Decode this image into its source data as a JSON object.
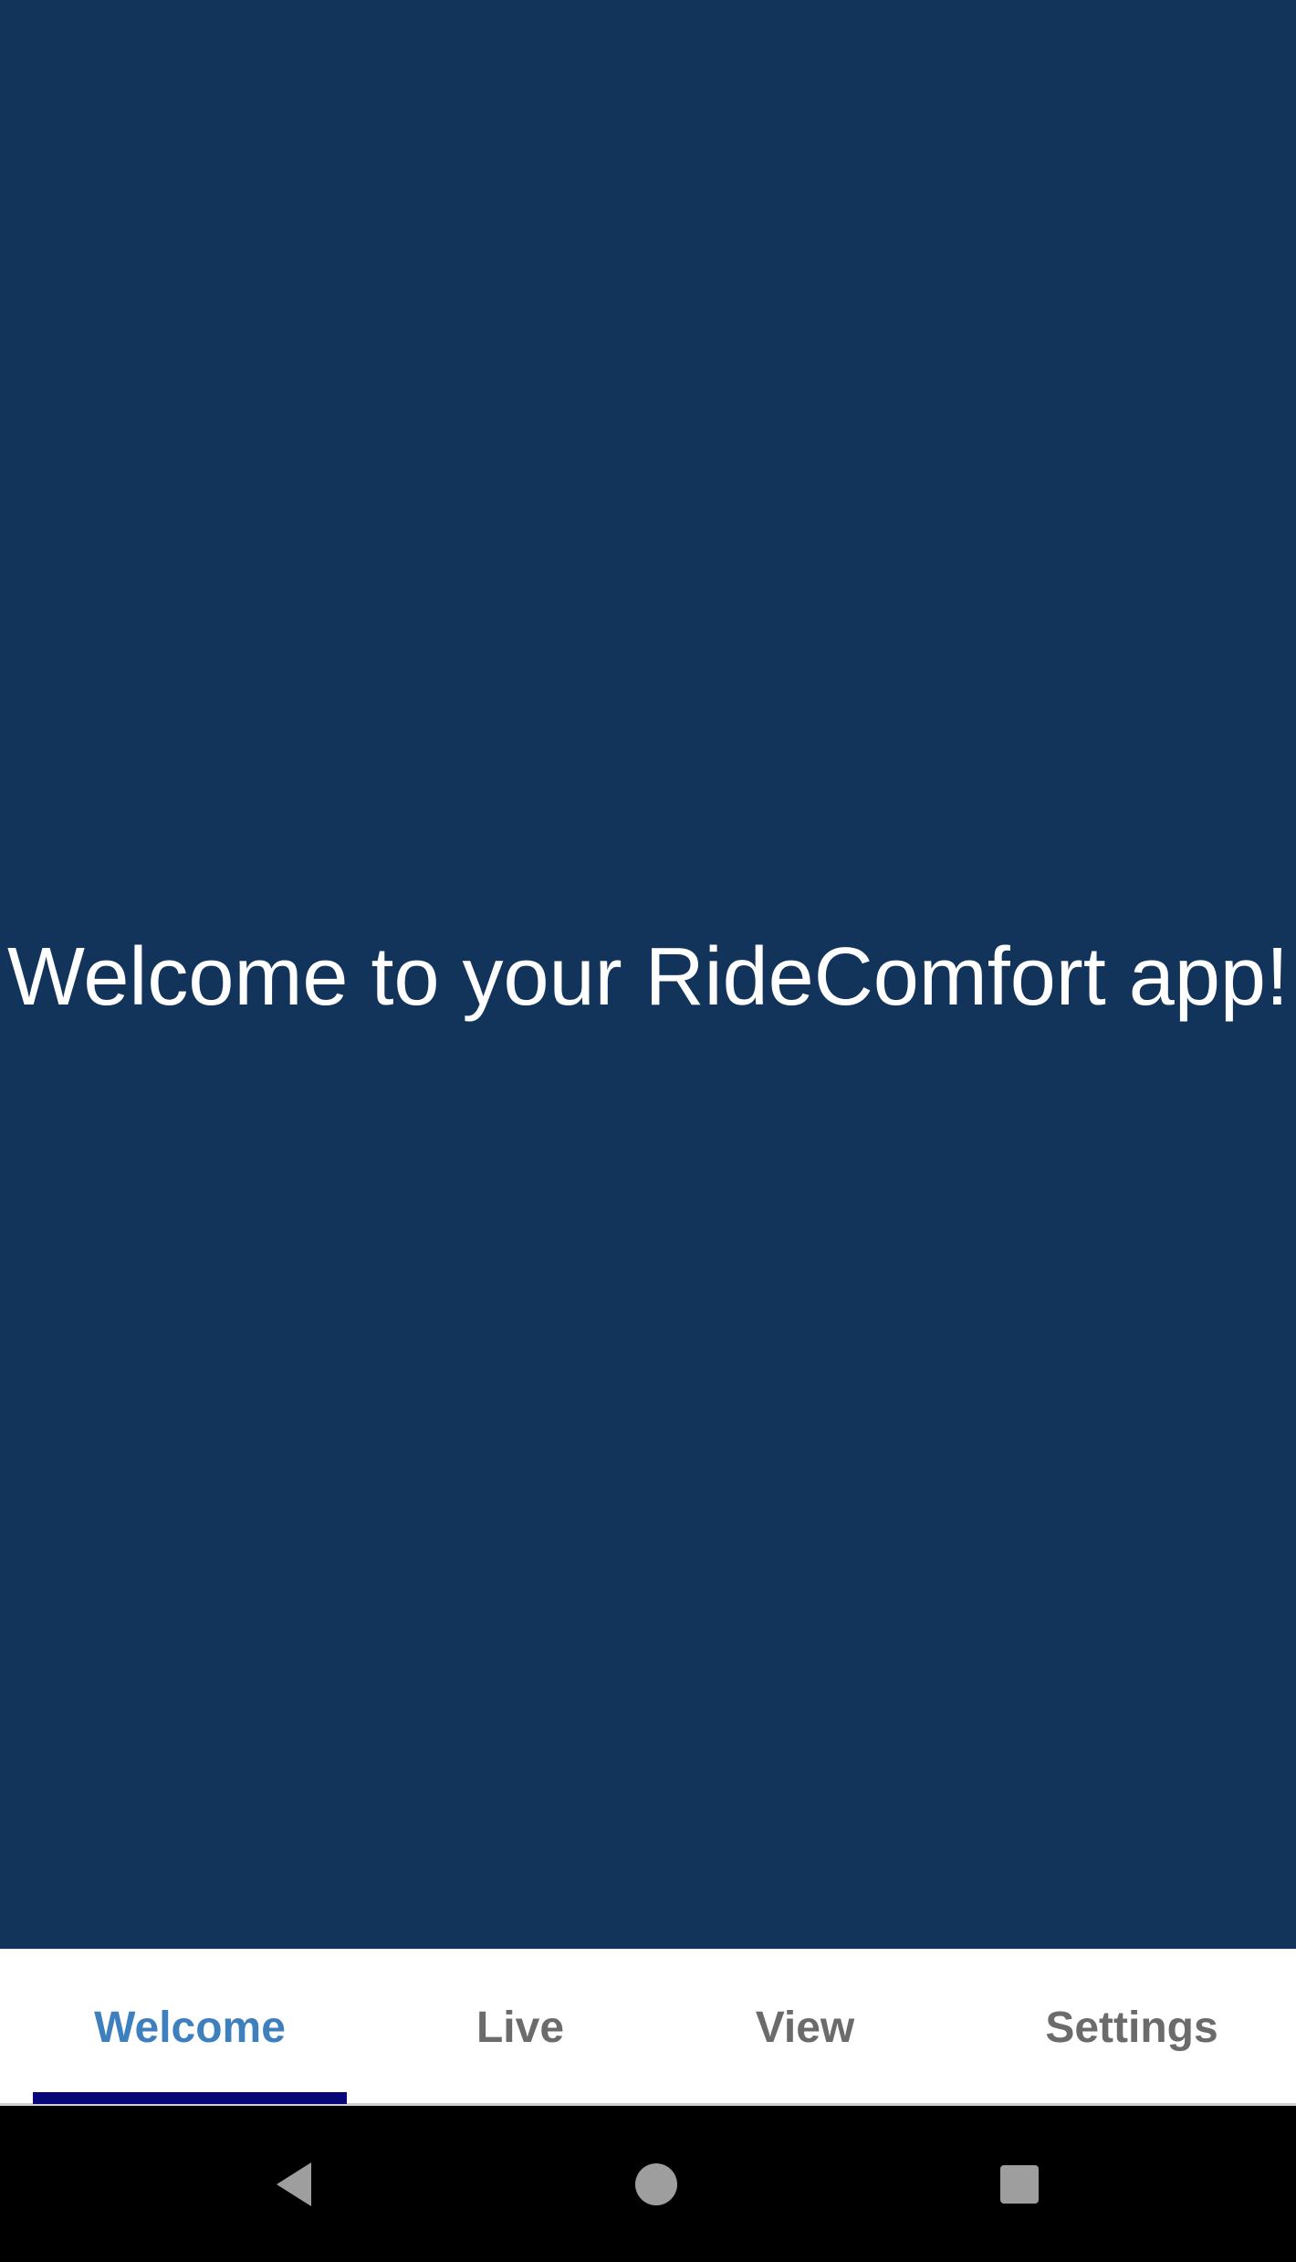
{
  "main": {
    "welcome_message": "Welcome to your RideComfort app!"
  },
  "tabs": [
    {
      "label": "Welcome",
      "active": true
    },
    {
      "label": "Live",
      "active": false
    },
    {
      "label": "View",
      "active": false
    },
    {
      "label": "Settings",
      "active": false
    }
  ],
  "navbar": {
    "icons": [
      "back-icon",
      "home-icon",
      "recents-icon"
    ]
  },
  "colors": {
    "background": "#13345a",
    "active_tab_text": "#3e7fbd",
    "inactive_tab_text": "#6b6b6b",
    "tab_indicator": "#07077a",
    "navbar_background": "#000000",
    "nav_icon": "#9e9e9e"
  }
}
